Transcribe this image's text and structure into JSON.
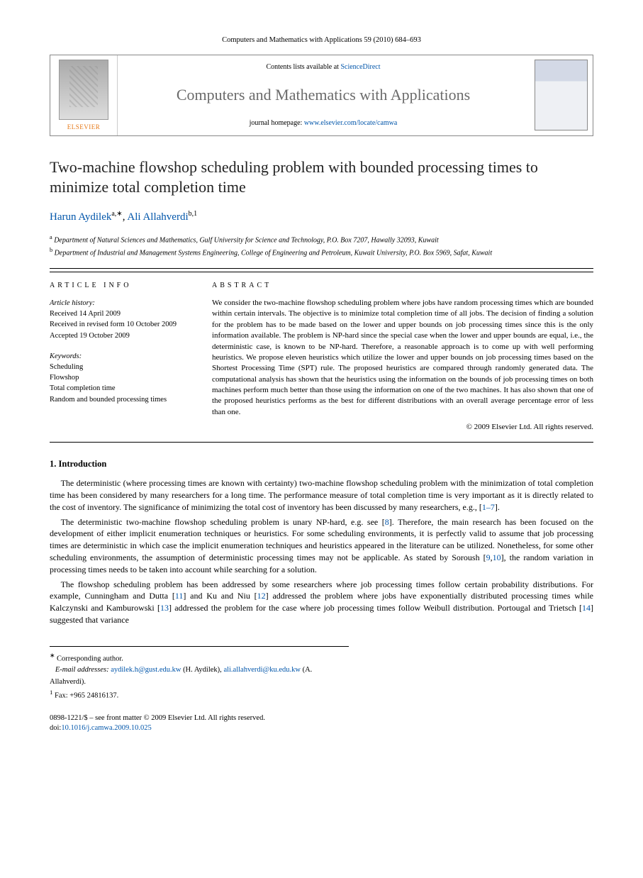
{
  "header": {
    "citation": "Computers and Mathematics with Applications 59 (2010) 684–693"
  },
  "banner": {
    "elsevier": "ELSEVIER",
    "contents_prefix": "Contents lists available at ",
    "contents_link": "ScienceDirect",
    "journal_name": "Computers and Mathematics with Applications",
    "homepage_prefix": "journal homepage: ",
    "homepage_url": "www.elsevier.com/locate/camwa"
  },
  "title": "Two-machine flowshop scheduling problem with bounded processing times to minimize total completion time",
  "authors": {
    "a1_name": "Harun Aydilek",
    "a1_sup": "a,∗",
    "sep": ", ",
    "a2_name": "Ali Allahverdi",
    "a2_sup": "b,1"
  },
  "affiliations": {
    "a": "Department of Natural Sciences and Mathematics, Gulf University for Science and Technology, P.O. Box 7207, Hawally 32093, Kuwait",
    "b": "Department of Industrial and Management Systems Engineering, College of Engineering and Petroleum, Kuwait University, P.O. Box 5969, Safat, Kuwait"
  },
  "article_info": {
    "heading": "ARTICLE INFO",
    "history_label": "Article history:",
    "received": "Received 14 April 2009",
    "revised": "Received in revised form 10 October 2009",
    "accepted": "Accepted 19 October 2009",
    "keywords_label": "Keywords:",
    "kw1": "Scheduling",
    "kw2": "Flowshop",
    "kw3": "Total completion time",
    "kw4": "Random and bounded processing times"
  },
  "abstract": {
    "heading": "ABSTRACT",
    "text": "We consider the two-machine flowshop scheduling problem where jobs have random processing times which are bounded within certain intervals. The objective is to minimize total completion time of all jobs. The decision of finding a solution for the problem has to be made based on the lower and upper bounds on job processing times since this is the only information available. The problem is NP-hard since the special case when the lower and upper bounds are equal, i.e., the deterministic case, is known to be NP-hard. Therefore, a reasonable approach is to come up with well performing heuristics. We propose eleven heuristics which utilize the lower and upper bounds on job processing times based on the Shortest Processing Time (SPT) rule. The proposed heuristics are compared through randomly generated data. The computational analysis has shown that the heuristics using the information on the bounds of job processing times on both machines perform much better than those using the information on one of the two machines. It has also shown that one of the proposed heuristics performs as the best for different distributions with an overall average percentage error of less than one.",
    "copyright": "© 2009 Elsevier Ltd. All rights reserved."
  },
  "section1": {
    "heading": "1. Introduction",
    "p1_a": "The deterministic (where processing times are known with certainty) two-machine flowshop scheduling problem with the minimization of total completion time has been considered by many researchers for a long time. The performance measure of total completion time is very important as it is directly related to the cost of inventory. The significance of minimizing the total cost of inventory has been discussed by many researchers, e.g., [",
    "p1_ref1": "1–7",
    "p1_b": "].",
    "p2_a": "The deterministic two-machine flowshop scheduling problem is unary NP-hard, e.g. see [",
    "p2_ref1": "8",
    "p2_b": "]. Therefore, the main research has been focused on the development of either implicit enumeration techniques or heuristics. For some scheduling environments, it is perfectly valid to assume that job processing times are deterministic in which case the implicit enumeration techniques and heuristics appeared in the literature can be utilized. Nonetheless, for some other scheduling environments, the assumption of deterministic processing times may not be applicable. As stated by Soroush [",
    "p2_ref2": "9",
    "p2_c": ",",
    "p2_ref3": "10",
    "p2_d": "], the random variation in processing times needs to be taken into account while searching for a solution.",
    "p3_a": "The flowshop scheduling problem has been addressed by some researchers where job processing times follow certain probability distributions. For example, Cunningham and Dutta [",
    "p3_ref1": "11",
    "p3_b": "] and Ku and Niu [",
    "p3_ref2": "12",
    "p3_c": "] addressed the problem where jobs have exponentially distributed processing times while Kalczynski and Kamburowski [",
    "p3_ref3": "13",
    "p3_d": "] addressed the problem for the case where job processing times follow Weibull distribution. Portougal and Trietsch [",
    "p3_ref4": "14",
    "p3_e": "] suggested that variance"
  },
  "footnotes": {
    "corr_label": "Corresponding author.",
    "email_label": "E-mail addresses:",
    "email1": "aydilek.h@gust.edu.kw",
    "email1_who": " (H. Aydilek), ",
    "email2": "ali.allahverdi@ku.edu.kw",
    "email2_who": " (A. Allahverdi).",
    "fax": "Fax: +965 24816137."
  },
  "footer": {
    "front_matter": "0898-1221/$ – see front matter © 2009 Elsevier Ltd. All rights reserved.",
    "doi_label": "doi:",
    "doi": "10.1016/j.camwa.2009.10.025"
  }
}
